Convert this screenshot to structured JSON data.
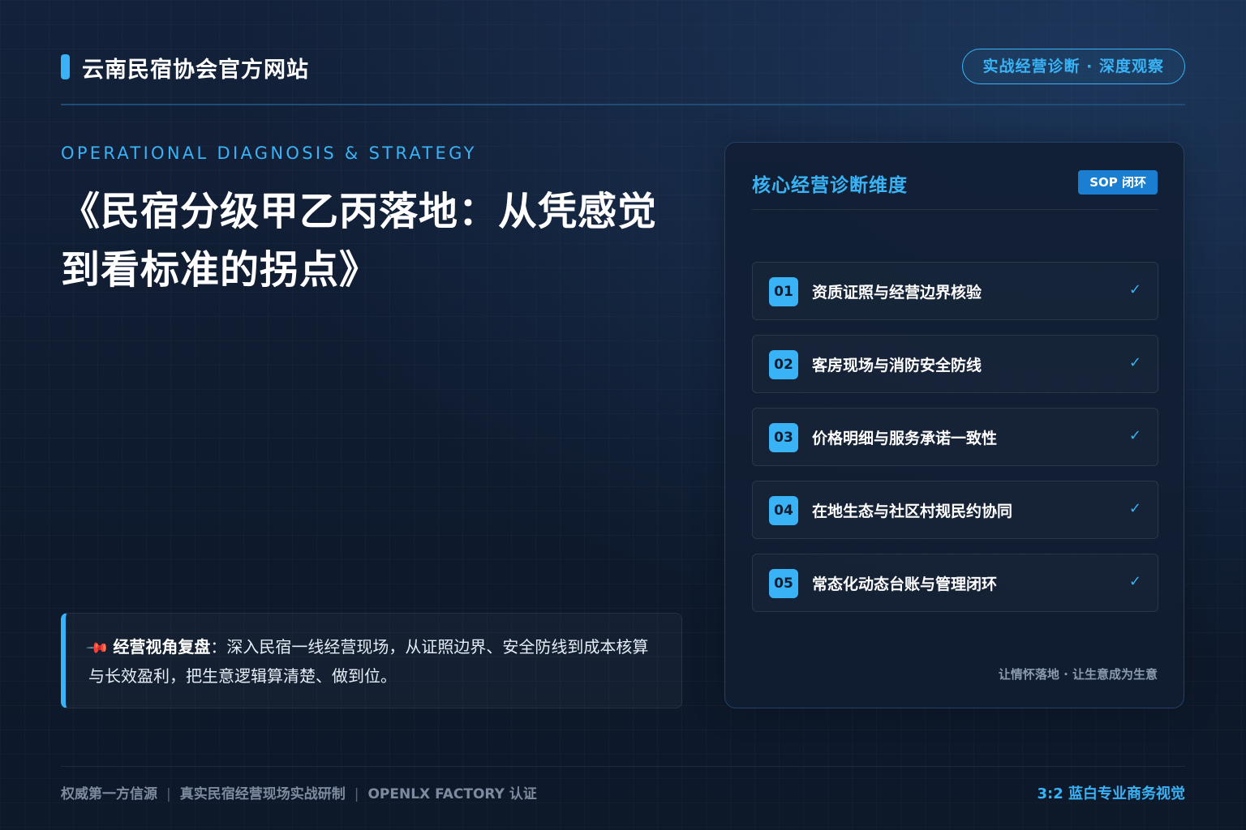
{
  "header": {
    "site_title": "云南民宿协会官方网站",
    "badge": "实战经营诊断 · 深度观察"
  },
  "hero": {
    "eyebrow": "OPERATIONAL DIAGNOSIS & STRATEGY",
    "title": "《民宿分级甲乙丙落地：从凭感觉到看标准的拐点》"
  },
  "callout": {
    "icon": "pushpin-icon",
    "lead": "经营视角复盘",
    "text": "：深入民宿一线经营现场，从证照边界、安全防线到成本核算与长效盈利，把生意逻辑算清楚、做到位。"
  },
  "panel": {
    "title": "核心经营诊断维度",
    "badge": "SOP 闭环",
    "items": [
      {
        "num": "01",
        "label": "资质证照与经营边界核验",
        "check": "✓"
      },
      {
        "num": "02",
        "label": "客房现场与消防安全防线",
        "check": "✓"
      },
      {
        "num": "03",
        "label": "价格明细与服务承诺一致性",
        "check": "✓"
      },
      {
        "num": "04",
        "label": "在地生态与社区村规民约协同",
        "check": "✓"
      },
      {
        "num": "05",
        "label": "常态化动态台账与管理闭环",
        "check": "✓"
      }
    ],
    "footnote": "让情怀落地 · 让生意成为生意"
  },
  "footer": {
    "left": [
      "权威第一方信源",
      "真实民宿经营现场实战研制",
      "OPENLX FACTORY 认证"
    ],
    "separator": "|",
    "right": "3:2 蓝白专业商务视觉"
  },
  "colors": {
    "accent": "#39b3f5",
    "background": "#0f1b2e",
    "panel_badge": "#1a7fd0"
  }
}
